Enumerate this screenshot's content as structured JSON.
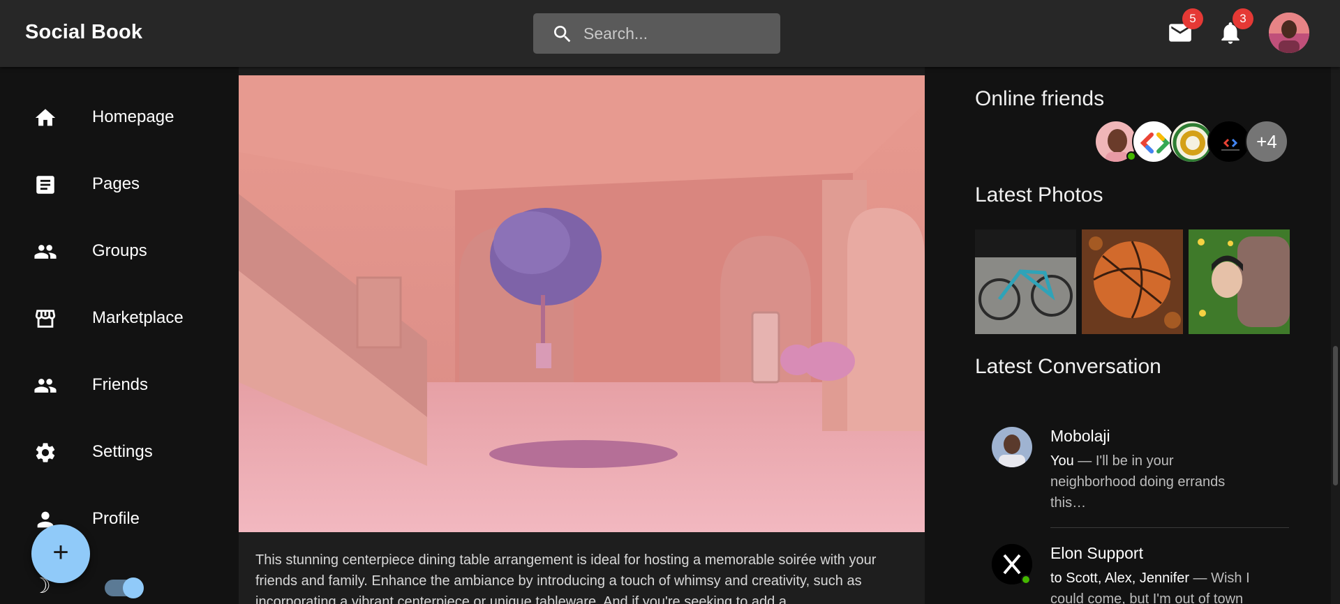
{
  "header": {
    "brand": "Social Book",
    "search_placeholder": "Search...",
    "mail_badge": "5",
    "notifications_badge": "3"
  },
  "sidebar": {
    "items": [
      {
        "label": "Homepage",
        "icon": "home-icon"
      },
      {
        "label": "Pages",
        "icon": "article-icon"
      },
      {
        "label": "Groups",
        "icon": "group-icon"
      },
      {
        "label": "Marketplace",
        "icon": "storefront-icon"
      },
      {
        "label": "Friends",
        "icon": "people-icon"
      },
      {
        "label": "Settings",
        "icon": "settings-icon"
      },
      {
        "label": "Profile",
        "icon": "person-icon"
      }
    ],
    "fab_label": "+",
    "dark_mode": true
  },
  "post": {
    "text": "This stunning centerpiece dining table arrangement is ideal for hosting a memorable soirée with your friends and family. Enhance the ambiance by introducing a touch of whimsy and creativity, such as incorporating a vibrant centerpiece or unique tableware. And if you're seeking to add a"
  },
  "rightbar": {
    "online_title": "Online friends",
    "online_more": "+4",
    "photos_title": "Latest Photos",
    "conversation_title": "Latest Conversation",
    "conversations": [
      {
        "name": "Mobolaji",
        "prefix": "You",
        "message": " — I'll be in your neighborhood doing errands this…"
      },
      {
        "name": "Elon Support",
        "prefix": "to Scott, Alex, Jennifer",
        "message": " — Wish I could come, but I'm out of town"
      }
    ]
  },
  "colors": {
    "header_bg": "#272727",
    "accent": "#90caf9",
    "badge": "#e53935",
    "online": "#44b700"
  }
}
